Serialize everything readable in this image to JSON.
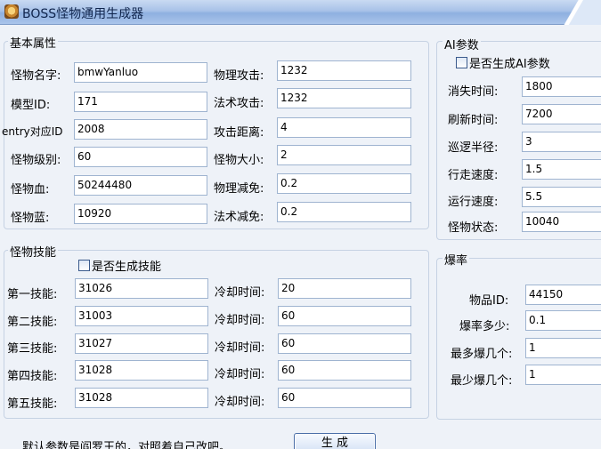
{
  "window": {
    "title": "BOSS怪物通用生成器"
  },
  "basic": {
    "legend": "基本属性",
    "left": [
      {
        "label": "怪物名字:",
        "value": "bmwYanluo"
      },
      {
        "label": "模型ID:",
        "value": "171"
      },
      {
        "label": "entry对应ID",
        "value": "2008"
      },
      {
        "label": "怪物级别:",
        "value": "60"
      },
      {
        "label": "怪物血:",
        "value": "50244480"
      },
      {
        "label": "怪物蓝:",
        "value": "10920"
      }
    ],
    "right": [
      {
        "label": "物理攻击:",
        "value": "1232"
      },
      {
        "label": "法术攻击:",
        "value": "1232"
      },
      {
        "label": "攻击距离:",
        "value": "4"
      },
      {
        "label": "怪物大小:",
        "value": "2"
      },
      {
        "label": "物理减免:",
        "value": "0.2"
      },
      {
        "label": "法术减免:",
        "value": "0.2"
      }
    ]
  },
  "skills": {
    "legend": "怪物技能",
    "checkbox_label": "是否生成技能",
    "rows": [
      {
        "label": "第一技能:",
        "value": "31026",
        "cd_label": "冷却时间:",
        "cd_value": "20"
      },
      {
        "label": "第二技能:",
        "value": "31003",
        "cd_label": "冷却时间:",
        "cd_value": "60"
      },
      {
        "label": "第三技能:",
        "value": "31027",
        "cd_label": "冷却时间:",
        "cd_value": "60"
      },
      {
        "label": "第四技能:",
        "value": "31028",
        "cd_label": "冷却时间:",
        "cd_value": "60"
      },
      {
        "label": "第五技能:",
        "value": "31028",
        "cd_label": "冷却时间:",
        "cd_value": "60"
      }
    ]
  },
  "ai": {
    "legend": "AI参数",
    "checkbox_label": "是否生成AI参数",
    "rows": [
      {
        "label": "消失时间:",
        "value": "1800"
      },
      {
        "label": "刷新时间:",
        "value": "7200"
      },
      {
        "label": "巡逻半径:",
        "value": "3"
      },
      {
        "label": "行走速度:",
        "value": "1.5"
      },
      {
        "label": "运行速度:",
        "value": "5.5"
      },
      {
        "label": "怪物状态:",
        "value": "10040"
      }
    ]
  },
  "drop": {
    "legend": "爆率",
    "rows": [
      {
        "label": "物品ID:",
        "value": "44150"
      },
      {
        "label": "爆率多少:",
        "value": "0.1"
      },
      {
        "label": "最多爆几个:",
        "value": "1"
      },
      {
        "label": "最少爆几个:",
        "value": "1"
      }
    ]
  },
  "footer": {
    "note": "默认参数是阎罗王的，对照着自己改吧。",
    "generate_label": "生 成"
  }
}
